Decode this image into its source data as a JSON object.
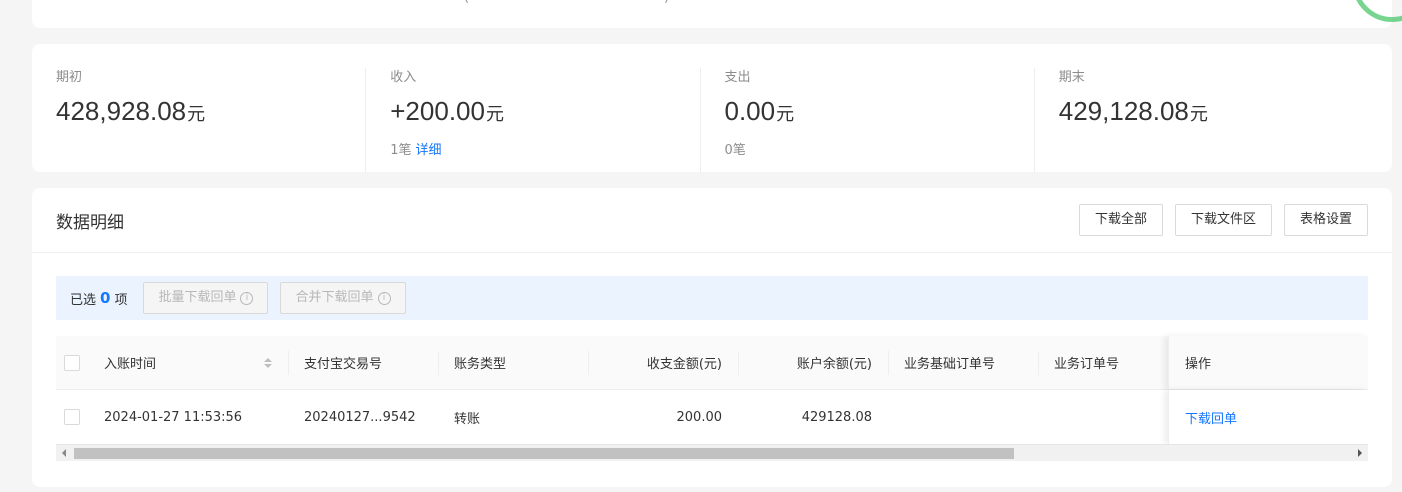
{
  "top_partial": {
    "left_paren": "(",
    "right_paren": ")"
  },
  "summary": [
    {
      "label": "期初",
      "value": "428,928.08",
      "unit": "元",
      "sub": "",
      "link": ""
    },
    {
      "label": "收入",
      "value": "+200.00",
      "unit": "元",
      "sub": "1笔",
      "link": "详细"
    },
    {
      "label": "支出",
      "value": "0.00",
      "unit": "元",
      "sub": "0笔",
      "link": ""
    },
    {
      "label": "期末",
      "value": "429,128.08",
      "unit": "元",
      "sub": "",
      "link": ""
    }
  ],
  "detail": {
    "title": "数据明细",
    "buttons": {
      "download_all": "下载全部",
      "download_area": "下载文件区",
      "table_settings": "表格设置"
    }
  },
  "select_bar": {
    "prefix": "已选",
    "count": "0",
    "suffix": "项",
    "batch_download": "批量下载回单",
    "merge_download": "合并下载回单",
    "info_glyph": "i"
  },
  "table": {
    "columns": {
      "time": "入账时间",
      "trade_no": "支付宝交易号",
      "type": "账务类型",
      "amount": "收支金额(元)",
      "balance": "账户余额(元)",
      "base_order": "业务基础订单号",
      "order": "业务订单号",
      "op": "操作"
    },
    "rows": [
      {
        "time": "2024-01-27 11:53:56",
        "trade_no": "20240127...9542",
        "type": "转账",
        "amount": "200.00",
        "balance": "429128.08",
        "base_order": "",
        "order": "",
        "op": "下载回单"
      }
    ]
  },
  "colors": {
    "accent": "#1677ff",
    "select_bar_bg": "#ebf3ff",
    "ring": "#4ac76a"
  }
}
